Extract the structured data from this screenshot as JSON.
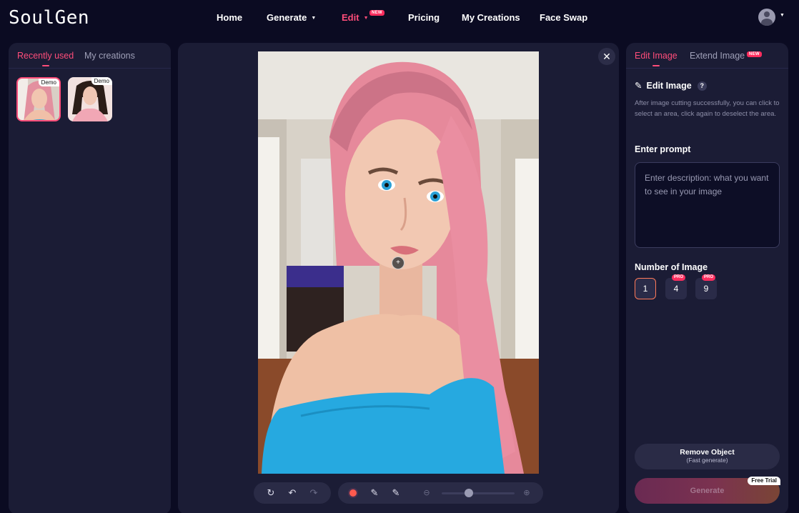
{
  "brand": {
    "logo": "SoulGen"
  },
  "nav": {
    "home": "Home",
    "generate": "Generate",
    "edit": "Edit",
    "edit_badge": "NEW",
    "pricing": "Pricing",
    "my_creations": "My Creations",
    "face_swap": "Face Swap"
  },
  "left_panel": {
    "tabs": [
      "Recently used",
      "My creations"
    ],
    "thumbnails": [
      {
        "tag": "Demo",
        "selected": true
      },
      {
        "tag": "Demo",
        "selected": false
      }
    ]
  },
  "center_panel": {
    "close_icon": "close-icon",
    "toolbar_history": [
      "rotate-icon",
      "undo-icon",
      "redo-icon"
    ],
    "toolbar_tools": [
      "brush-color-icon",
      "brush-add-icon",
      "brush-erase-icon",
      "zoom-out-icon",
      "zoom-in-icon"
    ],
    "zoom_level": 0.37
  },
  "right_panel": {
    "tabs": [
      "Edit Image",
      "Extend Image"
    ],
    "extend_badge": "NEW",
    "edit_title": "Edit Image",
    "help": "?",
    "description": "After image cutting successfully, you can click to select an area, click again to deselect the area.",
    "prompt_label": "Enter prompt",
    "prompt_placeholder": "Enter description: what you want to see in your image",
    "count_label": "Number of Image",
    "counts": [
      {
        "value": "1",
        "pro": ""
      },
      {
        "value": "4",
        "pro": "PRO"
      },
      {
        "value": "9",
        "pro": "PRO"
      }
    ],
    "remove_object": "Remove Object",
    "remove_object_sub": "(Fast generate)",
    "generate": "Generate",
    "free_trial": "Free Trial"
  },
  "colors": {
    "accent": "#ff4d7a",
    "background": "#0b0b22",
    "panel": "#1b1c35"
  }
}
